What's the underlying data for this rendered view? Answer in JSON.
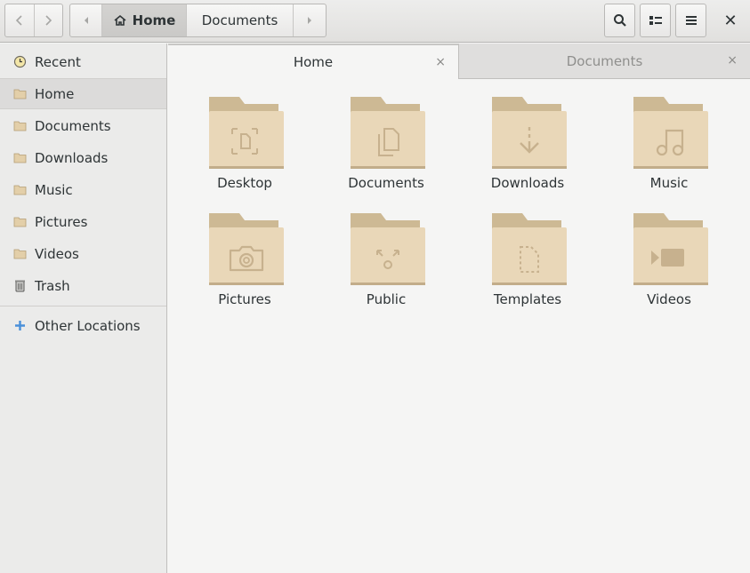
{
  "header": {
    "back_icon": "chevron-left-icon",
    "forward_icon": "chevron-right-icon",
    "path": {
      "crumbs": [
        "Home",
        "Documents"
      ]
    },
    "search_icon": "search-icon",
    "view_icon": "list-view-icon",
    "menu_icon": "hamburger-menu-icon",
    "close_glyph": "✕"
  },
  "sidebar": {
    "items": [
      {
        "label": "Recent",
        "icon": "clock-icon"
      },
      {
        "label": "Home",
        "icon": "home-folder-icon",
        "active": true
      },
      {
        "label": "Documents",
        "icon": "documents-folder-icon"
      },
      {
        "label": "Downloads",
        "icon": "downloads-folder-icon"
      },
      {
        "label": "Music",
        "icon": "music-folder-icon"
      },
      {
        "label": "Pictures",
        "icon": "pictures-folder-icon"
      },
      {
        "label": "Videos",
        "icon": "videos-folder-icon"
      },
      {
        "label": "Trash",
        "icon": "trash-icon"
      },
      {
        "label": "Other Locations",
        "icon": "plus-icon"
      }
    ]
  },
  "tabs": [
    {
      "label": "Home",
      "active": true,
      "close": "×"
    },
    {
      "label": "Documents",
      "active": false,
      "close": "×"
    }
  ],
  "folders": [
    {
      "label": "Desktop",
      "emblem": "desktop"
    },
    {
      "label": "Documents",
      "emblem": "documents"
    },
    {
      "label": "Downloads",
      "emblem": "downloads"
    },
    {
      "label": "Music",
      "emblem": "music"
    },
    {
      "label": "Pictures",
      "emblem": "pictures"
    },
    {
      "label": "Public",
      "emblem": "public"
    },
    {
      "label": "Templates",
      "emblem": "templates"
    },
    {
      "label": "Videos",
      "emblem": "videos"
    }
  ],
  "colors": {
    "folder_body": "#e9d7b8",
    "folder_tab": "#cdb994",
    "emblem": "#c7b18e",
    "accent": "#4a90d9"
  }
}
